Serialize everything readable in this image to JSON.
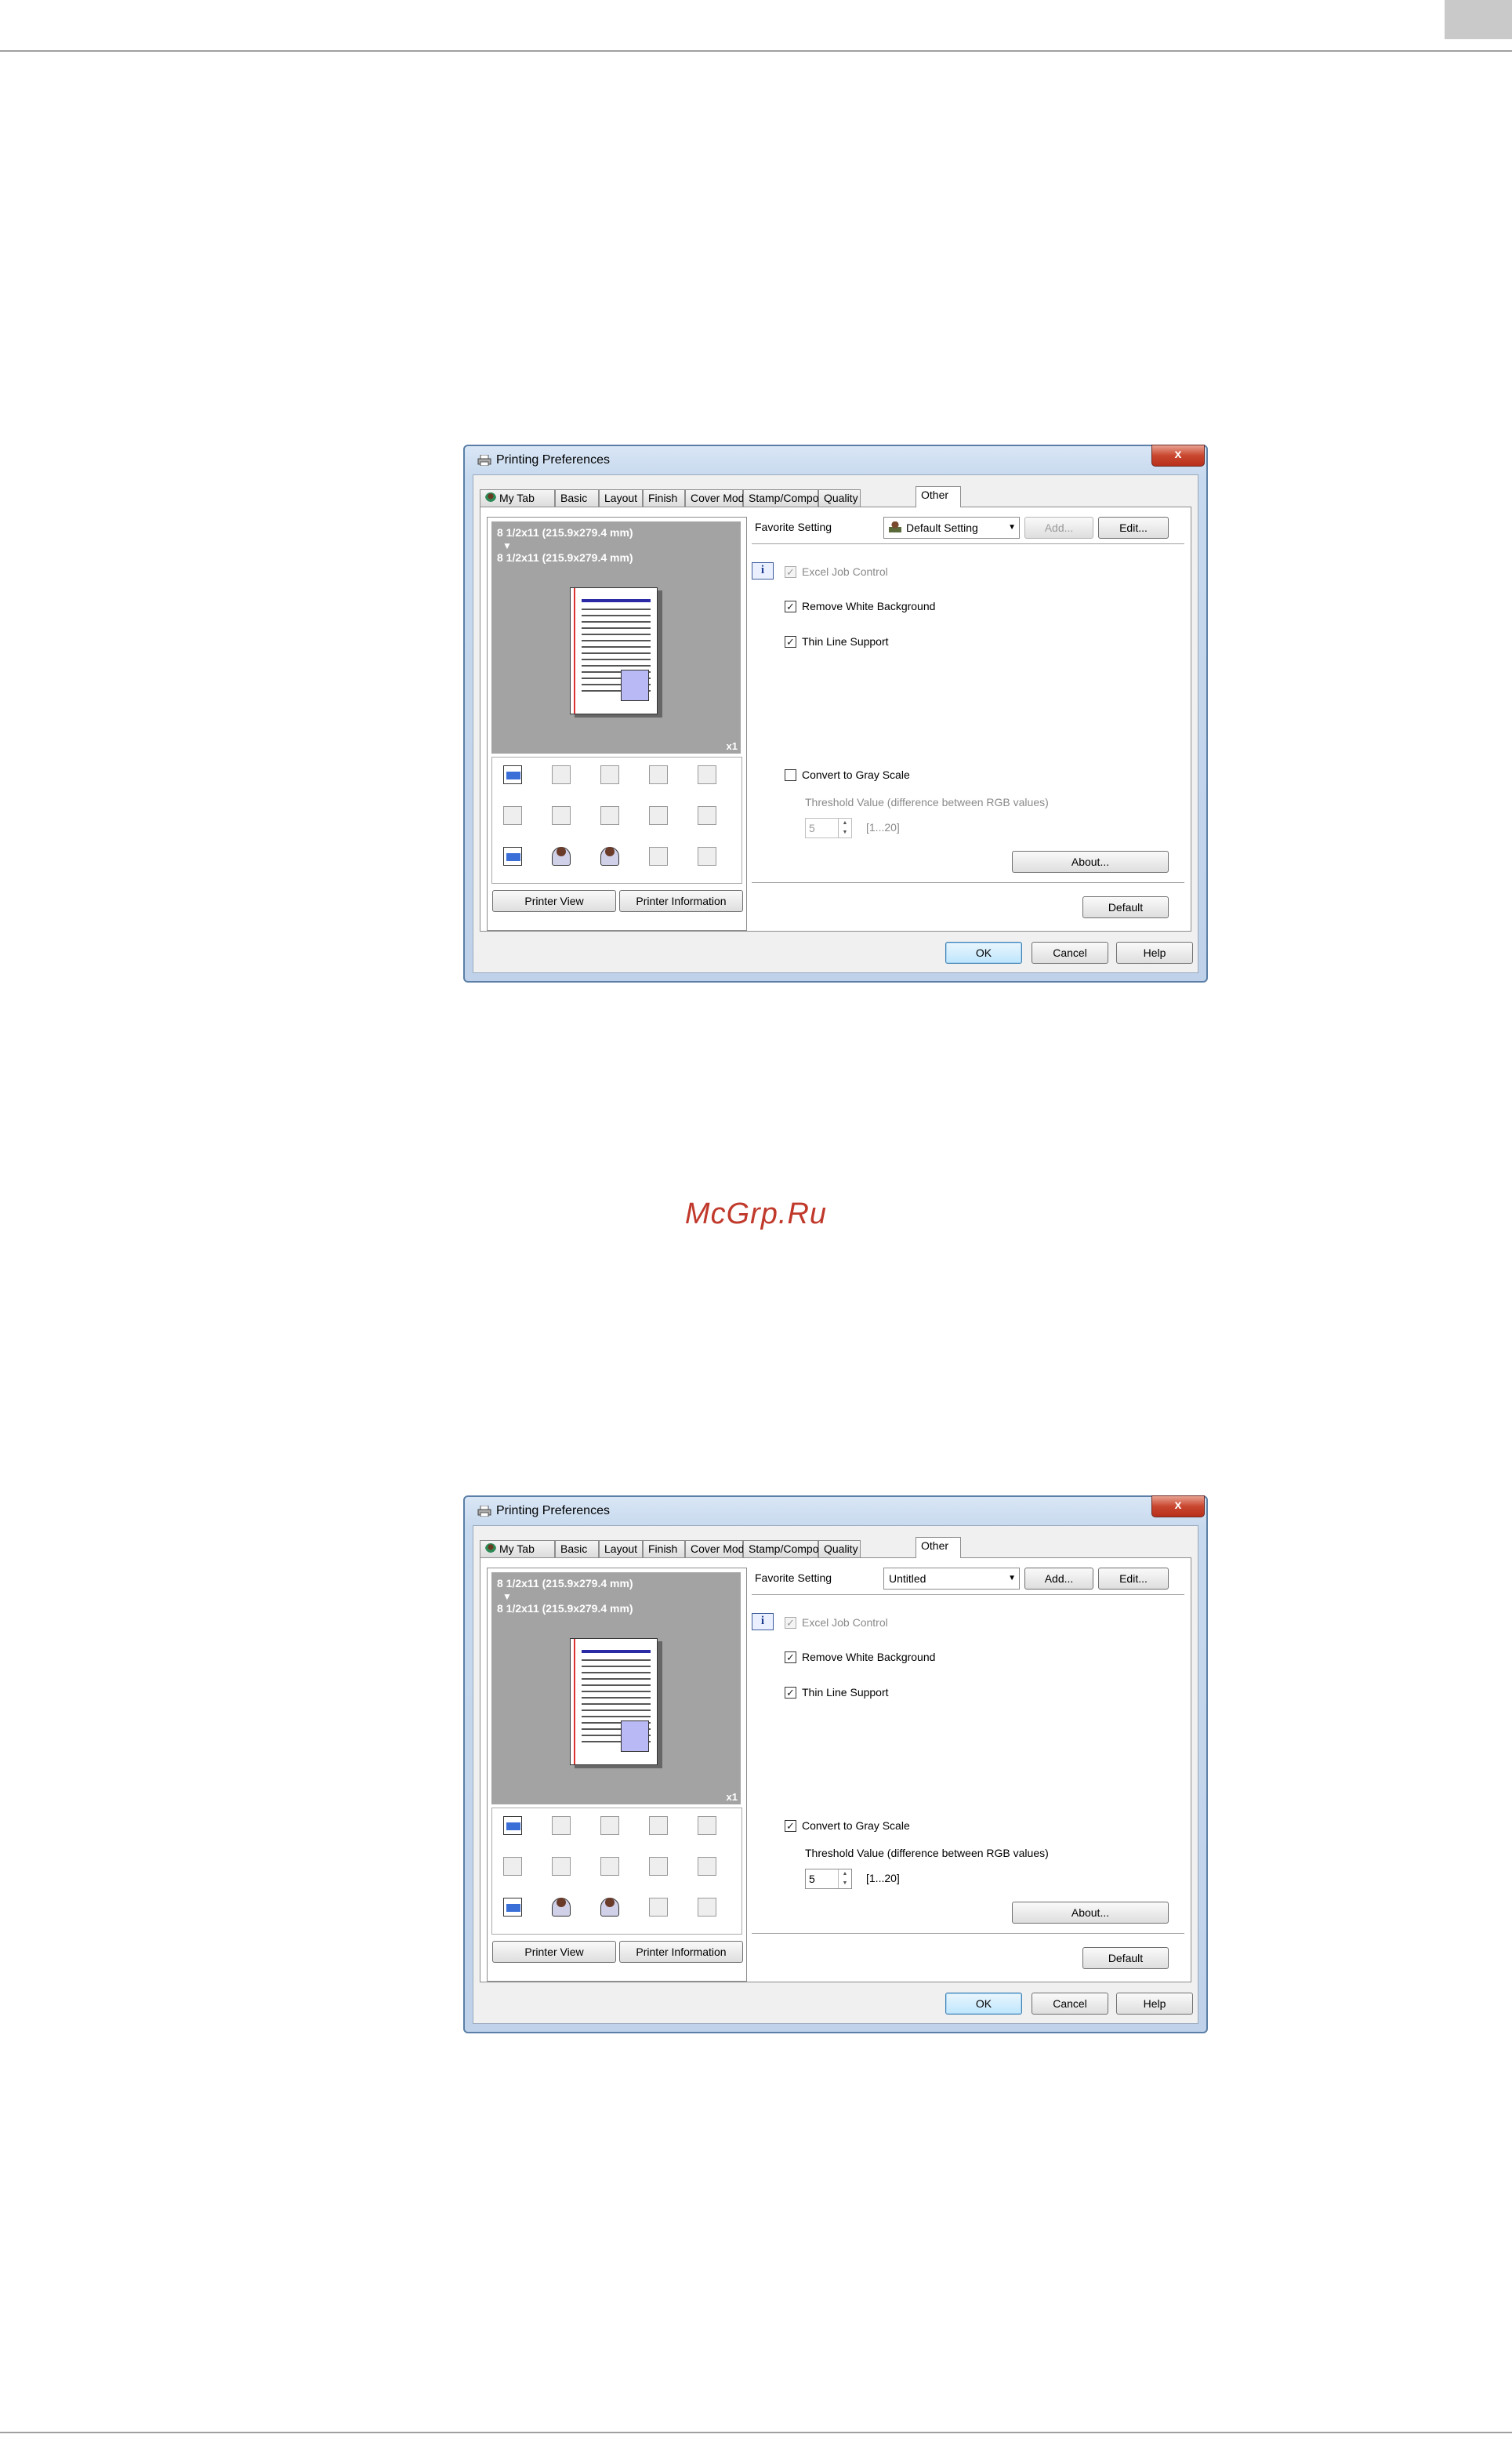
{
  "dialogs": [
    {
      "title": "Printing Preferences",
      "close_label": "x",
      "tabs": [
        {
          "label": "My Tab"
        },
        {
          "label": "Basic"
        },
        {
          "label": "Layout"
        },
        {
          "label": "Finish"
        },
        {
          "label": "Cover Mode"
        },
        {
          "label": "Stamp/Composition"
        },
        {
          "label": "Quality"
        },
        {
          "label": "Other"
        }
      ],
      "active_tab": "Other",
      "preview": {
        "line1": "8 1/2x11 (215.9x279.4 mm)",
        "arrow": "▼",
        "line2": "8 1/2x11 (215.9x279.4 mm)",
        "copies": "x1"
      },
      "printer_view_label": "Printer View",
      "printer_info_label": "Printer Information",
      "favorite_label": "Favorite Setting",
      "favorite_value": "Default Setting",
      "favorite_has_icon": true,
      "add_label": "Add...",
      "add_enabled": false,
      "edit_label": "Edit...",
      "excel_job_control": {
        "label": "Excel Job Control",
        "checked": true,
        "enabled": false
      },
      "remove_white_bg": {
        "label": "Remove White Background",
        "checked": true,
        "enabled": true
      },
      "thin_line_support": {
        "label": "Thin Line Support",
        "checked": true,
        "enabled": true
      },
      "gray_scale": {
        "label": "Convert to Gray Scale",
        "checked": false,
        "enabled": true
      },
      "threshold": {
        "label": "Threshold Value (difference between RGB values)",
        "value": "5",
        "range": "[1...20]",
        "enabled": false
      },
      "about_label": "About...",
      "default_label": "Default",
      "ok_label": "OK",
      "cancel_label": "Cancel",
      "help_label": "Help"
    },
    {
      "title": "Printing Preferences",
      "close_label": "x",
      "tabs": [
        {
          "label": "My Tab"
        },
        {
          "label": "Basic"
        },
        {
          "label": "Layout"
        },
        {
          "label": "Finish"
        },
        {
          "label": "Cover Mode"
        },
        {
          "label": "Stamp/Composition"
        },
        {
          "label": "Quality"
        },
        {
          "label": "Other"
        }
      ],
      "active_tab": "Other",
      "preview": {
        "line1": "8 1/2x11 (215.9x279.4 mm)",
        "arrow": "▼",
        "line2": "8 1/2x11 (215.9x279.4 mm)",
        "copies": "x1"
      },
      "printer_view_label": "Printer View",
      "printer_info_label": "Printer Information",
      "favorite_label": "Favorite Setting",
      "favorite_value": "Untitled",
      "favorite_has_icon": false,
      "add_label": "Add...",
      "add_enabled": true,
      "edit_label": "Edit...",
      "excel_job_control": {
        "label": "Excel Job Control",
        "checked": true,
        "enabled": false
      },
      "remove_white_bg": {
        "label": "Remove White Background",
        "checked": true,
        "enabled": true
      },
      "thin_line_support": {
        "label": "Thin Line Support",
        "checked": true,
        "enabled": true
      },
      "gray_scale": {
        "label": "Convert to Gray Scale",
        "checked": true,
        "enabled": true
      },
      "threshold": {
        "label": "Threshold Value (difference between RGB values)",
        "value": "5",
        "range": "[1...20]",
        "enabled": true
      },
      "about_label": "About...",
      "default_label": "Default",
      "ok_label": "OK",
      "cancel_label": "Cancel",
      "help_label": "Help"
    }
  ],
  "watermark": "McGrp.Ru",
  "colors": {
    "accent": "#c0392b",
    "close": "#c9462f",
    "frame": "#5b7fa6"
  }
}
